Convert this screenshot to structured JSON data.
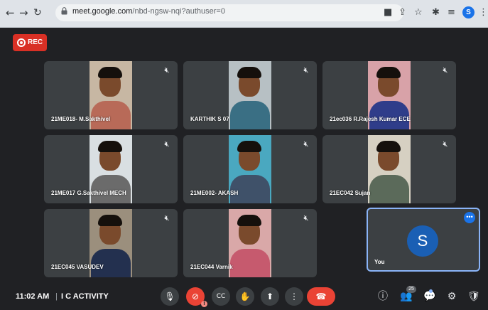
{
  "browser": {
    "url_host": "meet.google.com",
    "url_path": "/nbd-ngsw-nqi?authuser=0",
    "profile_initial": "S"
  },
  "recording": {
    "label": "REC"
  },
  "participants": [
    {
      "name": "21ME018- M.Sakthivel",
      "shirt": "#b86a58",
      "bg": "#c7b7a3"
    },
    {
      "name": "KARTHIK S 07",
      "shirt": "#3a6f84",
      "bg": "#b7c0c4"
    },
    {
      "name": "21ec036 R.Rajesh Kumar ECE",
      "shirt": "#2f3d8a",
      "bg": "#d8a2a8"
    },
    {
      "name": "21ME017 G.Sakthivel MECH",
      "shirt": "#6b6b6b",
      "bg": "#d9dfe2"
    },
    {
      "name": "21ME002- AKASH",
      "shirt": "#3f5169",
      "bg": "#4aa8c0"
    },
    {
      "name": "21EC042 Sujan",
      "shirt": "#5b6a5a",
      "bg": "#d6d0c2"
    },
    {
      "name": "21EC045 VASUDEV",
      "shirt": "#23304f",
      "bg": "#9b8f7d"
    },
    {
      "name": "21EC044 Varnik",
      "shirt": "#c65a6e",
      "bg": "#d9a8a8"
    }
  ],
  "self_tile": {
    "avatar_initial": "S",
    "label": "You"
  },
  "bottom_bar": {
    "time": "11:02 AM",
    "separator": "|",
    "meeting_name": "I C ACTIVITY",
    "participant_count": "25"
  }
}
